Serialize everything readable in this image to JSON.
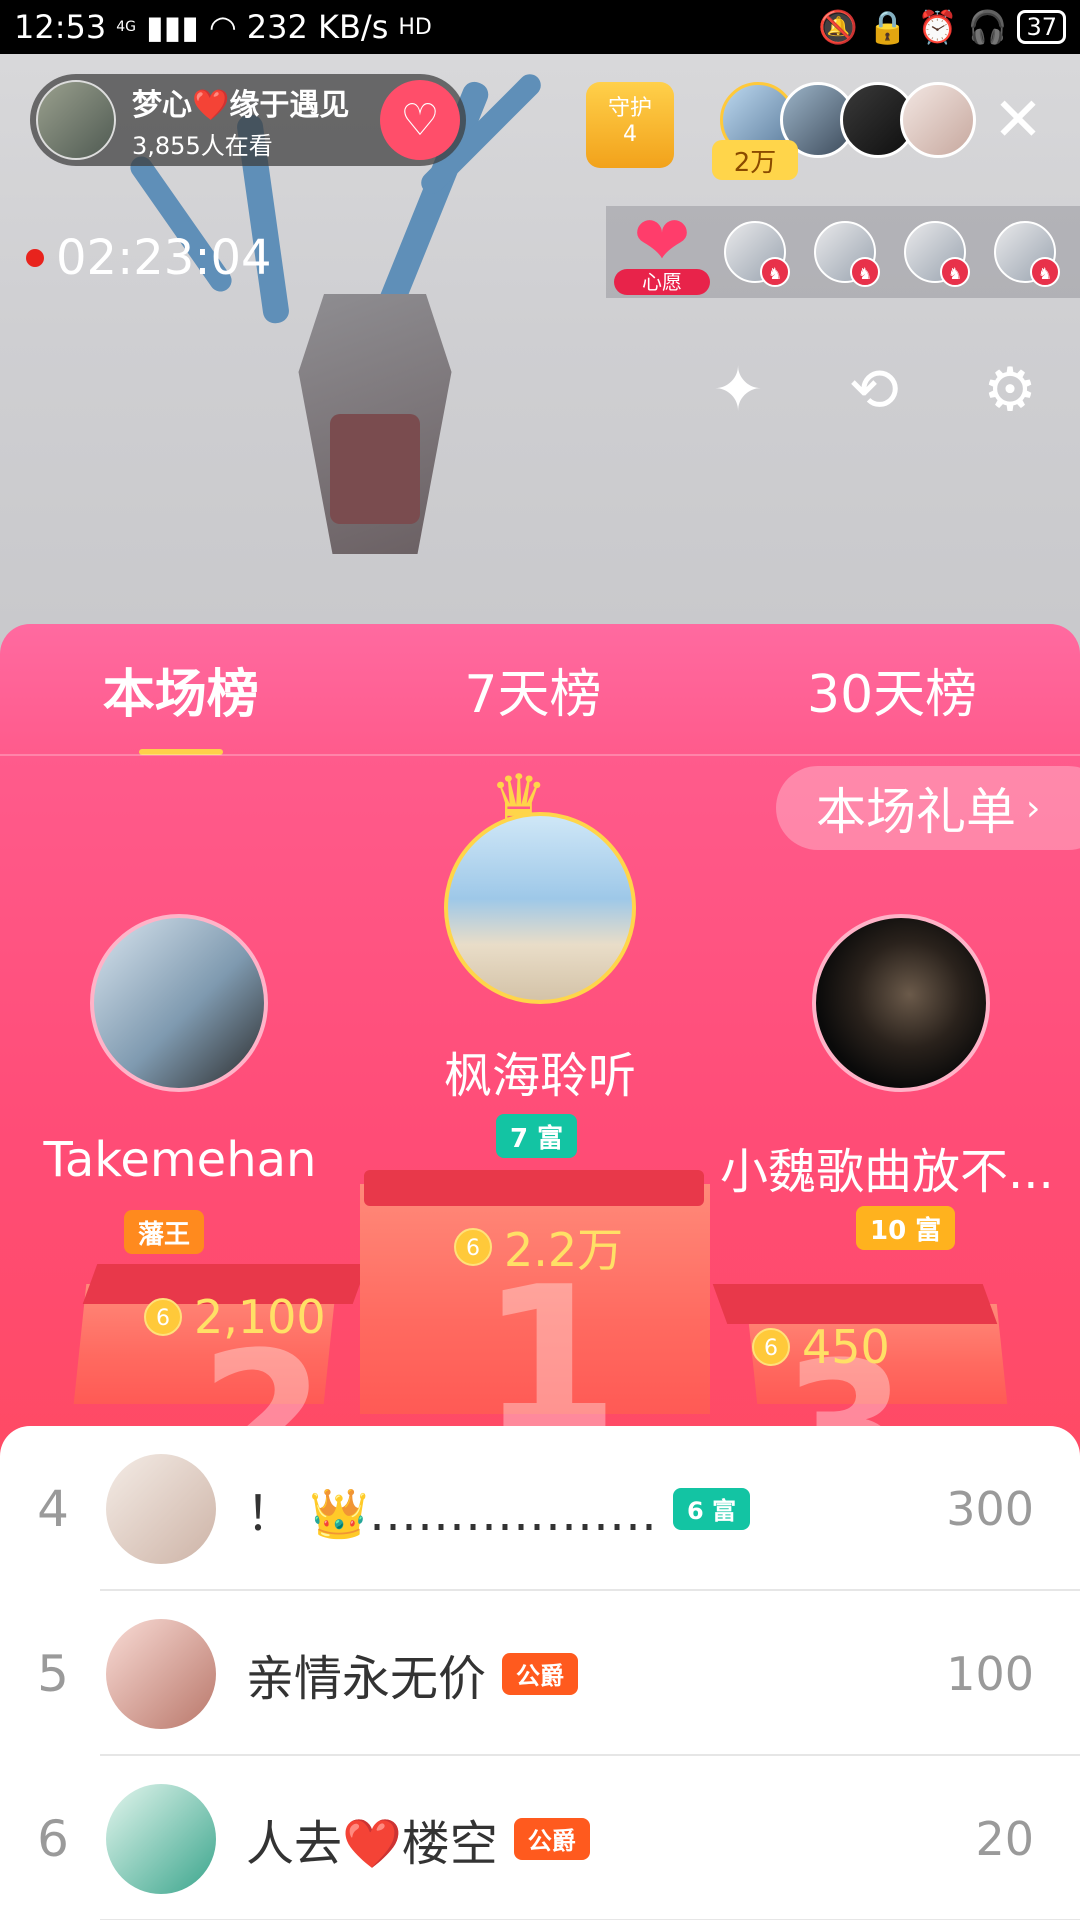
{
  "status_bar": {
    "time": "12:53",
    "network": "4G",
    "speed": "232 KB/s",
    "hd": "HD",
    "battery": "37"
  },
  "host": {
    "name": "梦心❤️缘于遇见",
    "viewers": "3,855人在看",
    "follow_icon": "heart-plus-icon"
  },
  "guard": {
    "label": "守护",
    "count": "4"
  },
  "top_viewers_badge": "2万",
  "stream_timer": "02:23:04",
  "wish": {
    "label": "心愿"
  },
  "tabs": [
    {
      "label": "本场榜",
      "active": true
    },
    {
      "label": "7天榜",
      "active": false
    },
    {
      "label": "30天榜",
      "active": false
    }
  ],
  "gift_list_button": "本场礼单",
  "podium": {
    "first": {
      "rank": "1",
      "name": "枫海聆听",
      "badge": "7 富",
      "badge_color": "#13c4a3",
      "score": "2.2万"
    },
    "second": {
      "rank": "2",
      "name": "Takemehan",
      "badge": "藩王",
      "badge_color": "#ff8a1e",
      "score": "2,100"
    },
    "third": {
      "rank": "3",
      "name": "小魏歌曲放不...",
      "badge": "10 富",
      "badge_color": "#ffb21e",
      "score": "450"
    }
  },
  "list": [
    {
      "rank": "4",
      "name": "！ 👑………………",
      "tag": "6 富",
      "tag_color": "#13c4a3",
      "score": "300"
    },
    {
      "rank": "5",
      "name": "亲情永无价",
      "tag": "公爵",
      "tag_color": "#ff5a1e",
      "score": "100"
    },
    {
      "rank": "6",
      "name": "人去❤️楼空",
      "tag": "公爵",
      "tag_color": "#ff5a1e",
      "score": "20"
    }
  ]
}
